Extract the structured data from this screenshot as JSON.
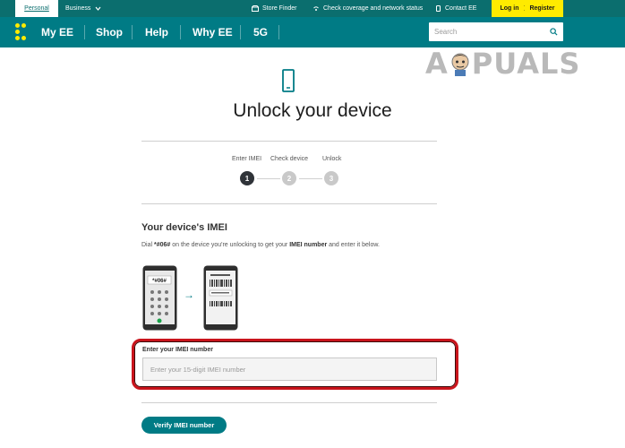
{
  "topbar": {
    "personal": "Personal",
    "business": "Business",
    "store_finder": "Store Finder",
    "coverage": "Check coverage and network status",
    "contact": "Contact EE",
    "login": "Log in",
    "register": "Register"
  },
  "nav": {
    "items": [
      "My EE",
      "Shop",
      "Help",
      "Why EE",
      "5G"
    ],
    "search_placeholder": "Search"
  },
  "watermark": {
    "text_a": "A",
    "text_b": "PUALS"
  },
  "page": {
    "title": "Unlock your device",
    "steps": [
      {
        "label": "Enter IMEI",
        "number": "1",
        "active": true
      },
      {
        "label": "Check device",
        "number": "2",
        "active": false
      },
      {
        "label": "Unlock",
        "number": "3",
        "active": false
      }
    ],
    "section_title": "Your device's IMEI",
    "instr_prefix": "Dial ",
    "instr_code": "*#06#",
    "instr_mid": " on the device you're unlocking to get your ",
    "instr_bold": "IMEI number",
    "instr_suffix": " and enter it below.",
    "illus_code": "*#06#",
    "imei_label": "Enter your IMEI number",
    "imei_placeholder": "Enter your 15-digit IMEI number",
    "verify_label": "Verify IMEI number"
  },
  "colors": {
    "brand_teal": "#007b85",
    "topbar": "#0b6e6e",
    "accent_yellow": "#ffeb00",
    "highlight_red": "#c9141c"
  }
}
